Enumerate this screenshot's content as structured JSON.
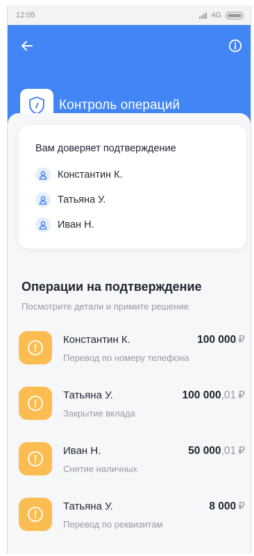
{
  "status": {
    "time": "12:05",
    "network": "4G"
  },
  "header": {
    "title": "Контроль операций"
  },
  "trust": {
    "title": "Вам доверяет подтверждение",
    "people": [
      "Константин К.",
      "Татьяна У.",
      "Иван Н."
    ]
  },
  "operations": {
    "title": "Операции на подтверждение",
    "subtitle": "Посмотрите детали и примите решение",
    "items": [
      {
        "name": "Константин К.",
        "desc": "Перевод по номеру телефона",
        "amount_int": "100 000",
        "amount_frac": "",
        "currency": "₽"
      },
      {
        "name": "Татьяна У.",
        "desc": "Закрытие вклада",
        "amount_int": "100 000",
        "amount_frac": ",01",
        "currency": "₽"
      },
      {
        "name": "Иван Н.",
        "desc": "Снятие наличных",
        "amount_int": "50 000",
        "amount_frac": ",01",
        "currency": "₽"
      },
      {
        "name": "Татьяна У.",
        "desc": "Перевод по реквизитам",
        "amount_int": "8 000",
        "amount_frac": "",
        "currency": "₽"
      }
    ]
  },
  "icons": {
    "back": "arrow-left-icon",
    "info": "info-icon",
    "shield": "shield-icon",
    "person": "person-icon",
    "warning": "exclamation-circle-icon"
  },
  "colors": {
    "accent": "#4285f4",
    "warning": "#fbbd52",
    "text": "#1f2430",
    "muted": "#9599a3"
  }
}
